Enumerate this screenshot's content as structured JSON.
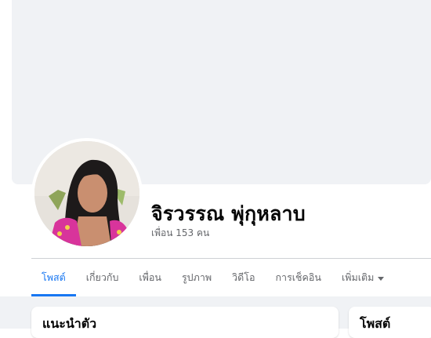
{
  "profile": {
    "name": "จิรวรรณ พุ่กุหลาบ",
    "friends_label": "เพื่อน 153 คน"
  },
  "tabs": [
    {
      "label": "โพสต์",
      "active": true
    },
    {
      "label": "เกี่ยวกับ",
      "active": false
    },
    {
      "label": "เพื่อน",
      "active": false
    },
    {
      "label": "รูปภาพ",
      "active": false
    },
    {
      "label": "วิดีโอ",
      "active": false
    },
    {
      "label": "การเช็คอิน",
      "active": false
    },
    {
      "label": "เพิ่มเติม",
      "active": false
    }
  ],
  "cards": {
    "intro_title": "แนะนำตัว",
    "posts_title": "โพสต์"
  },
  "icons": {
    "more_tab": "caret-down-icon"
  },
  "colors": {
    "accent": "#1877f2",
    "cover": "#f0f2f5",
    "muted_text": "#65676b",
    "divider": "#ced0d4"
  }
}
